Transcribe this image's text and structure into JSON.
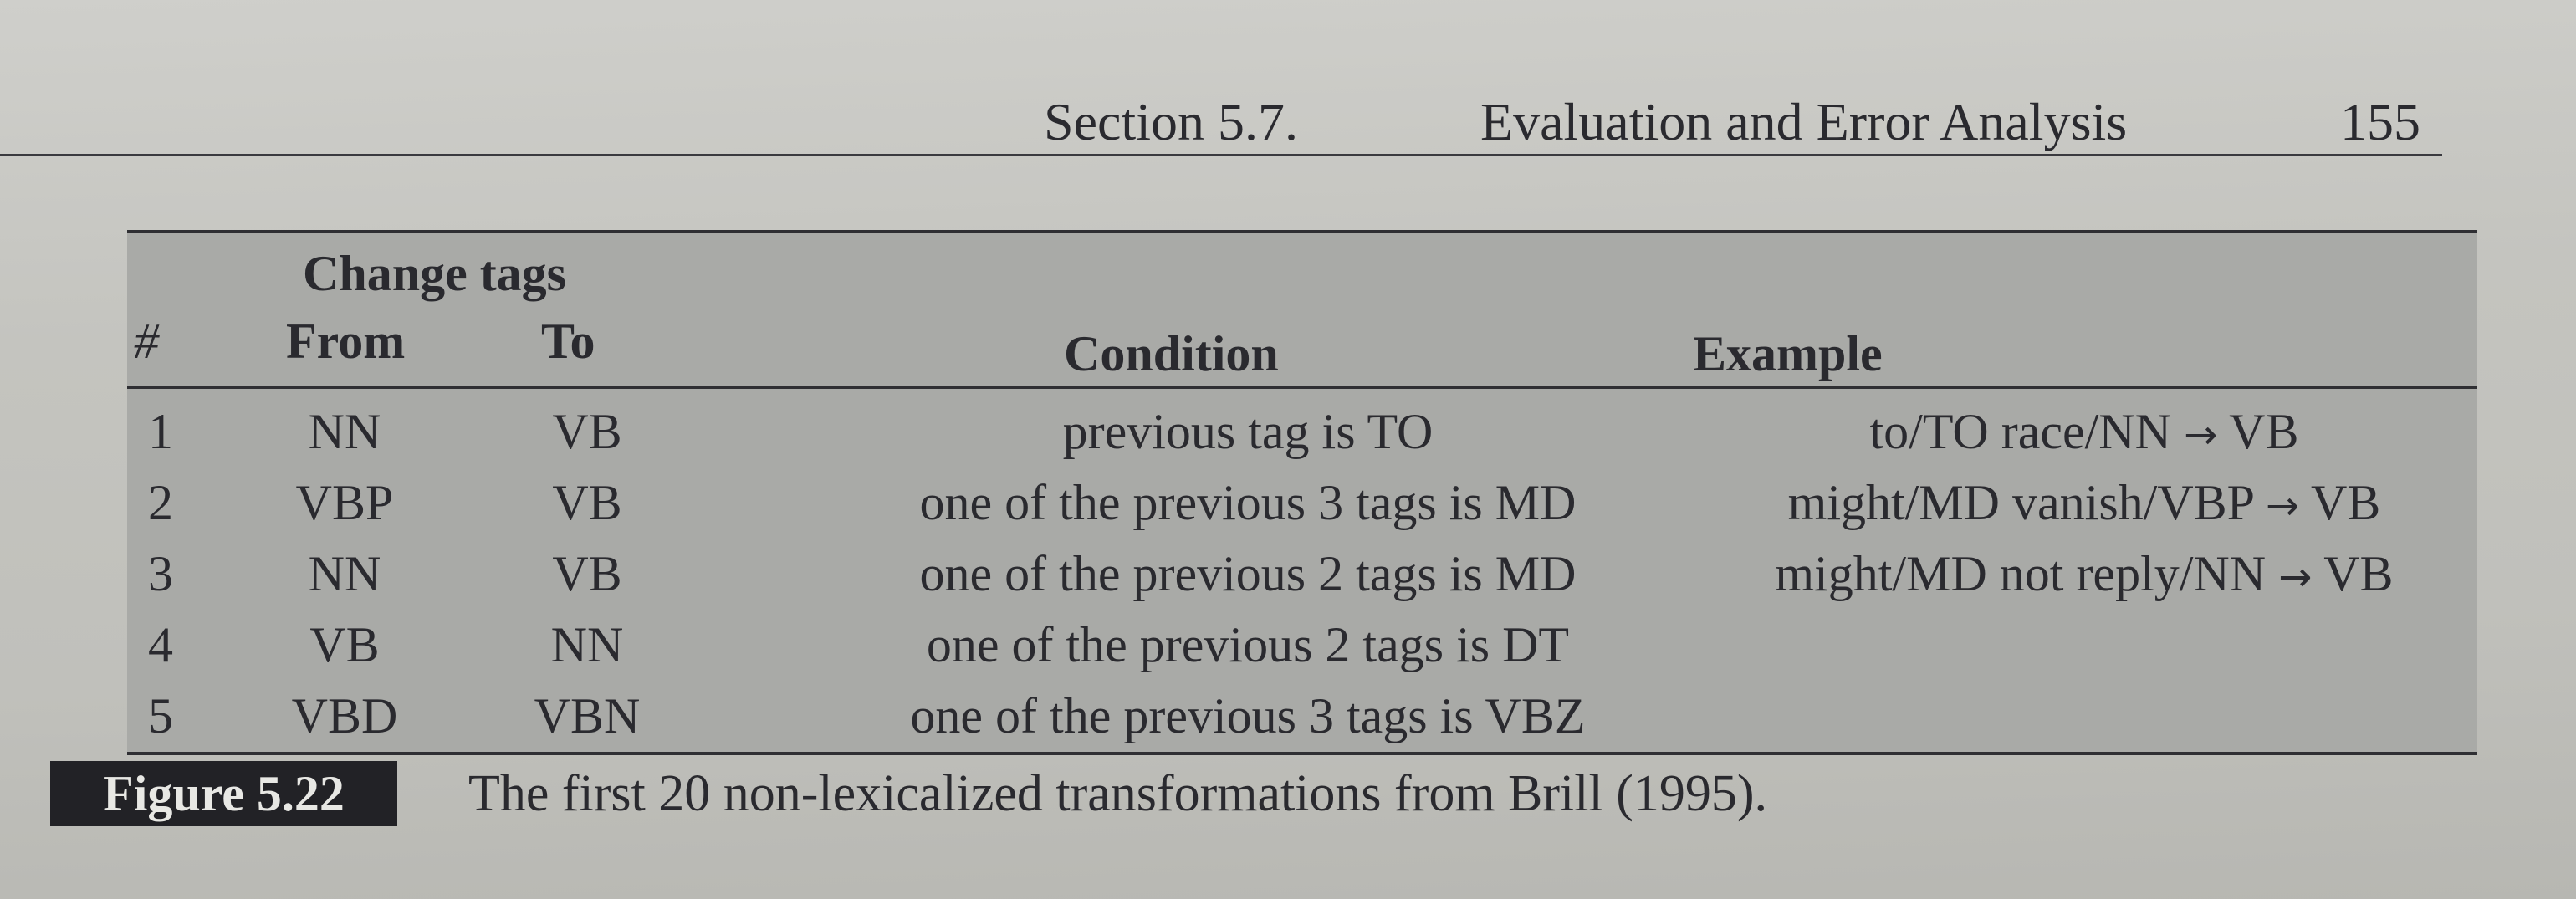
{
  "running_head": {
    "section": "Section 5.7.",
    "title": "Evaluation and Error Analysis",
    "page_number": "155"
  },
  "table": {
    "headers": {
      "group": "Change tags",
      "number": "#",
      "from": "From",
      "to": "To",
      "condition": "Condition",
      "example": "Example"
    },
    "rows": [
      {
        "num": "1",
        "from": "NN",
        "to": "VB",
        "condition": "previous tag is TO",
        "example_pre": "to/TO race/NN",
        "arrow": "→",
        "example_post": "VB"
      },
      {
        "num": "2",
        "from": "VBP",
        "to": "VB",
        "condition": "one of the previous 3 tags is MD",
        "example_pre": "might/MD vanish/VBP",
        "arrow": "→",
        "example_post": "VB"
      },
      {
        "num": "3",
        "from": "NN",
        "to": "VB",
        "condition": "one of the previous 2 tags is MD",
        "example_pre": "might/MD not reply/NN",
        "arrow": "→",
        "example_post": "VB"
      },
      {
        "num": "4",
        "from": "VB",
        "to": "NN",
        "condition": "one of the previous 2 tags is DT",
        "example_pre": "",
        "arrow": "",
        "example_post": ""
      },
      {
        "num": "5",
        "from": "VBD",
        "to": "VBN",
        "condition": "one of the previous 3 tags is VBZ",
        "example_pre": "",
        "arrow": "",
        "example_post": ""
      }
    ]
  },
  "caption": {
    "label": "Figure 5.22",
    "text": "The first 20 non-lexicalized transformations from Brill (1995)."
  }
}
